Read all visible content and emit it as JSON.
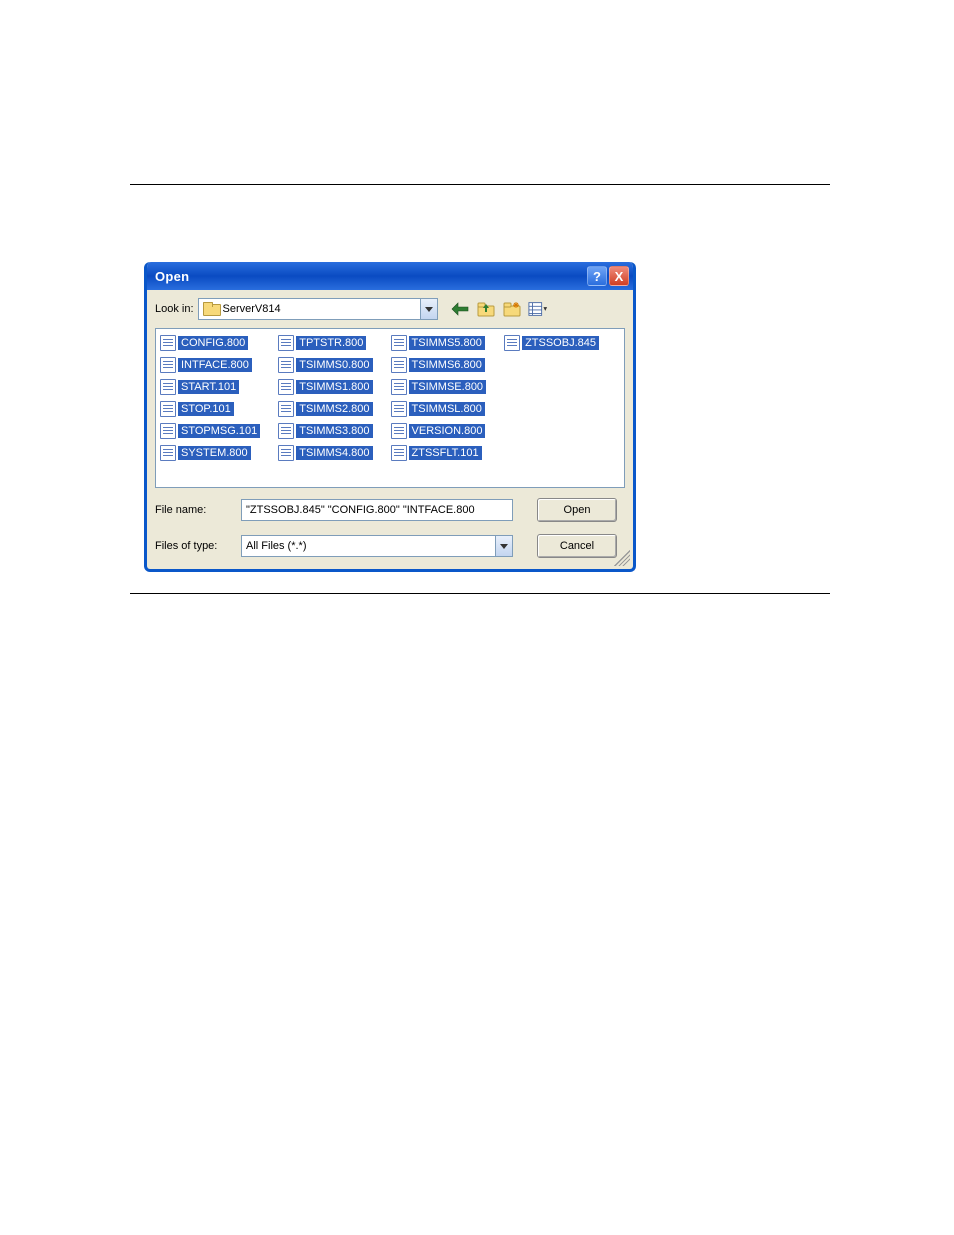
{
  "doc_links": {
    "top_link": "",
    "bottom_link": ""
  },
  "dialog": {
    "title": "Open",
    "help_char": "?",
    "close_char": "X",
    "lookin_label": "Look in:",
    "lookin_value": "ServerV814",
    "filename_label": "File name:",
    "filename_value": "\"ZTSSOBJ.845\" \"CONFIG.800\" \"INTFACE.800",
    "filetype_label": "Files of type:",
    "filetype_value": "All Files (*.*)",
    "open_btn": "Open",
    "cancel_btn": "Cancel"
  },
  "files": {
    "col1": [
      "CONFIG.800",
      "INTFACE.800",
      "START.101",
      "STOP.101",
      "STOPMSG.101",
      "SYSTEM.800"
    ],
    "col2": [
      "TPTSTR.800",
      "TSIMMS0.800",
      "TSIMMS1.800",
      "TSIMMS2.800",
      "TSIMMS3.800",
      "TSIMMS4.800"
    ],
    "col3": [
      "TSIMMS5.800",
      "TSIMMS6.800",
      "TSIMMSE.800",
      "TSIMMSL.800",
      "VERSION.800",
      "ZTSSFLT.101"
    ],
    "col4": [
      "ZTSSOBJ.845"
    ]
  }
}
